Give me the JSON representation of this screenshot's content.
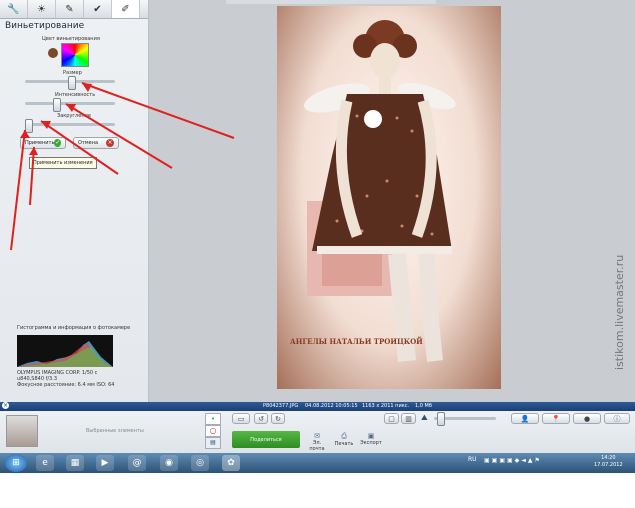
{
  "panel": {
    "title": "Виньетирование",
    "color_label": "Цвет виньетирования",
    "size_label": "Размер",
    "size_value": 0.52,
    "intensity_label": "Интенсивность",
    "intensity_value": 0.34,
    "roundness_label": "Закругление",
    "roundness_value": 0.0,
    "apply_label": "Применить",
    "cancel_label": "Отмена",
    "tooltip": "Применить изменения"
  },
  "histogram": {
    "title": "Гистограмма и информация о фотокамере",
    "cam_line1": "OLYMPUS IMAGING CORP.  1/50 с",
    "cam_line2": "u840,S840        f/3.3",
    "cam_line3": "Фокусное расстояние: 6.4 мм  ISO: 64"
  },
  "photo": {
    "caption": "АНГЕЛЫ НАТАЛЬИ ТРОИЦКОЙ"
  },
  "status": {
    "filename": "P8042377.JPG",
    "date": "04.08.2012 10:05:15",
    "dims": "1163 x 2011 пикс.",
    "size": "1,0 Мб"
  },
  "bottom": {
    "selected_label": "Выбранные элементы",
    "share_label": "Поделиться",
    "email_label": "Эл. почта",
    "print_label": "Печать",
    "export_label": "Экспорт"
  },
  "taskbar": {
    "lang": "RU",
    "time": "14:20",
    "date": "17.07.2012"
  },
  "watermark": "istikom.livemaster.ru",
  "colors": {
    "accent_green": "#3aa935",
    "status_blue": "#2d5b97",
    "taskbar": "#4a7aa6",
    "arrow_red": "#e0201e"
  },
  "icons": [
    "wrench-icon",
    "sun-icon",
    "brush-icon",
    "check-paint-icon",
    "effects-icon",
    "rotate-left-icon",
    "rotate-right-icon",
    "zoom-icon",
    "person-icon",
    "pin-icon",
    "info-icon"
  ]
}
